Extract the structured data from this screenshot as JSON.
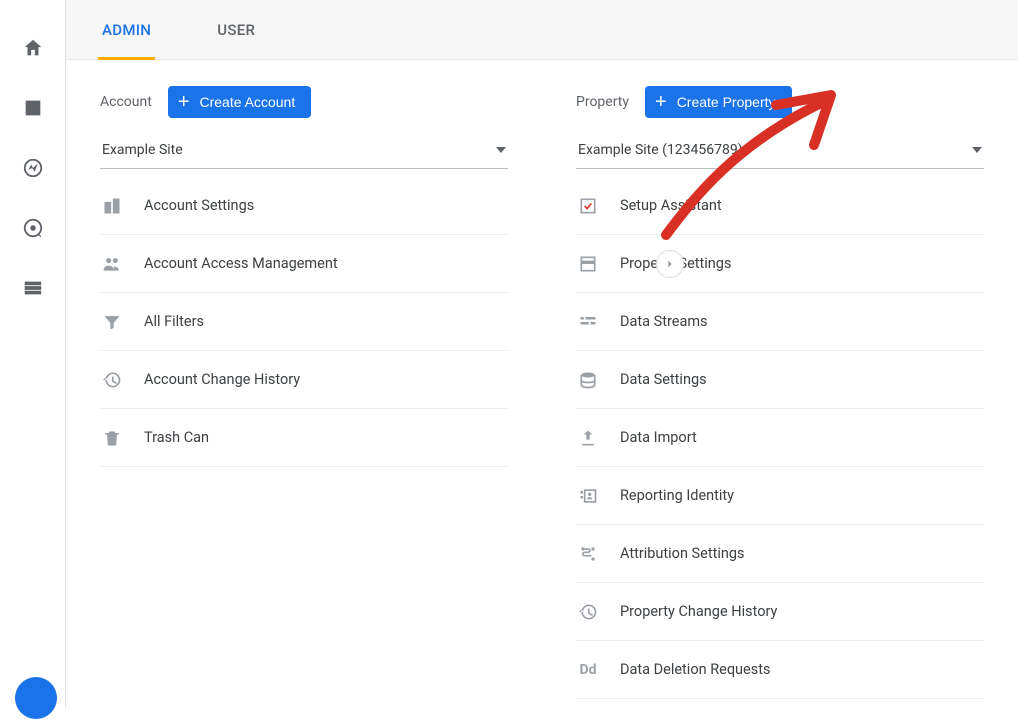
{
  "rail": {
    "items": [
      {
        "name": "home-icon"
      },
      {
        "name": "bar-chart-icon"
      },
      {
        "name": "explore-icon"
      },
      {
        "name": "target-icon"
      },
      {
        "name": "list-icon"
      }
    ]
  },
  "tabs": {
    "admin": "ADMIN",
    "user": "USER"
  },
  "account": {
    "heading": "Account",
    "create_label": "Create Account",
    "selected": "Example Site",
    "items": [
      {
        "label": "Account Settings",
        "icon": "building-icon"
      },
      {
        "label": "Account Access Management",
        "icon": "people-icon"
      },
      {
        "label": "All Filters",
        "icon": "filter-icon"
      },
      {
        "label": "Account Change History",
        "icon": "history-icon"
      },
      {
        "label": "Trash Can",
        "icon": "trash-icon"
      }
    ]
  },
  "property": {
    "heading": "Property",
    "create_label": "Create Property",
    "selected": "Example Site (123456789)",
    "items": [
      {
        "label": "Setup Assistant",
        "icon": "check-square-icon"
      },
      {
        "label": "Property Settings",
        "icon": "layout-icon"
      },
      {
        "label": "Data Streams",
        "icon": "streams-icon"
      },
      {
        "label": "Data Settings",
        "icon": "stack-icon"
      },
      {
        "label": "Data Import",
        "icon": "upload-icon"
      },
      {
        "label": "Reporting Identity",
        "icon": "identity-icon"
      },
      {
        "label": "Attribution Settings",
        "icon": "attribution-icon"
      },
      {
        "label": "Property Change History",
        "icon": "history-icon"
      },
      {
        "label": "Data Deletion Requests",
        "icon": "dd-icon"
      }
    ]
  }
}
